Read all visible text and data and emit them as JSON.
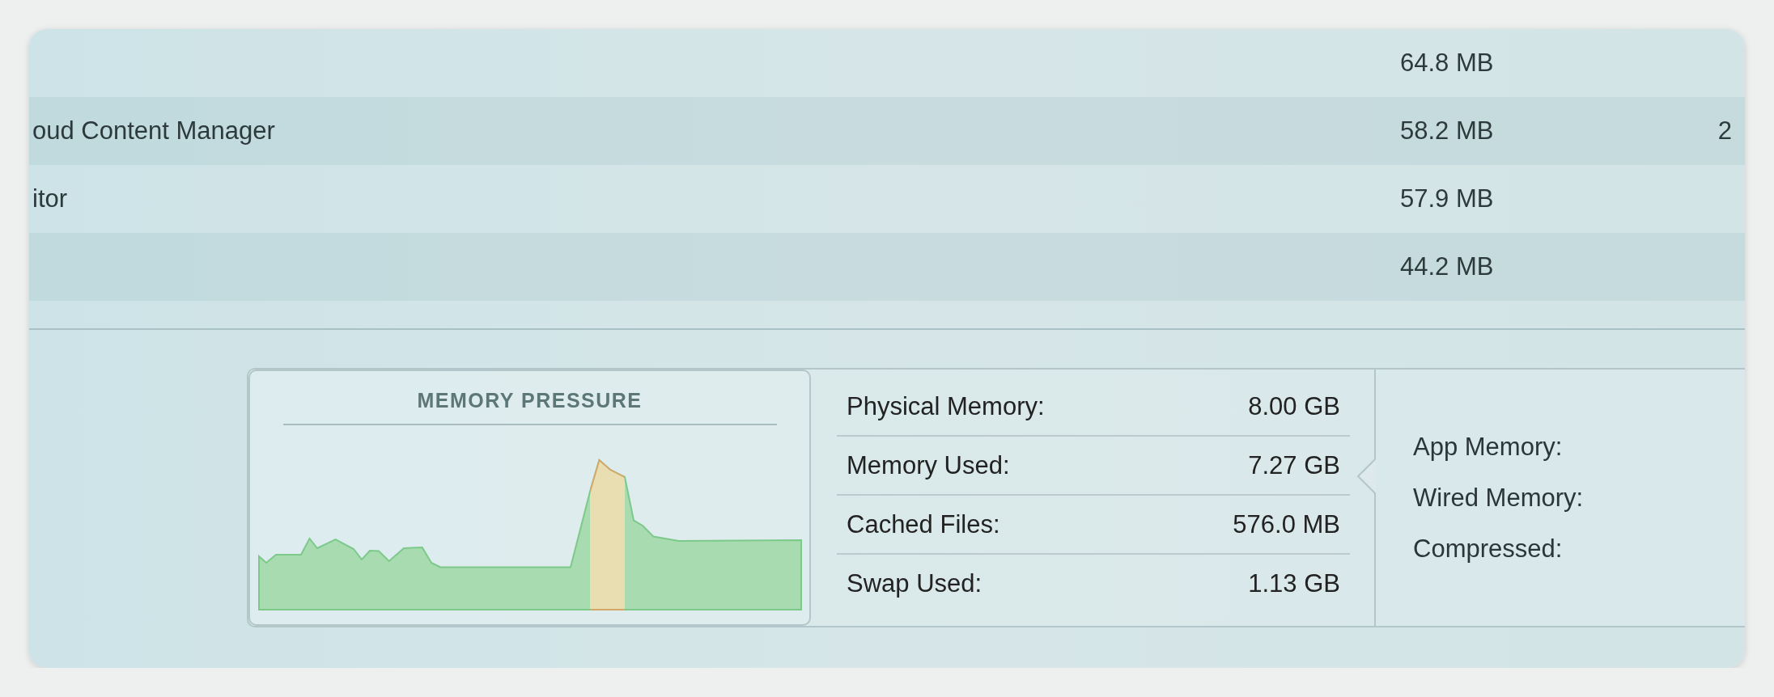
{
  "table": {
    "rows": [
      {
        "memory": "64.8 MB"
      },
      {
        "name": "oud Content Manager",
        "memory": "58.2 MB",
        "column_3": "2"
      },
      {
        "name": "itor",
        "memory": "57.9 MB"
      },
      {
        "memory": "44.2 MB"
      }
    ]
  },
  "memory_pressure": {
    "title": "MEMORY PRESSURE"
  },
  "stats": [
    {
      "label": "Physical Memory:",
      "value": "8.00 GB"
    },
    {
      "label": "Memory Used:",
      "value": "7.27 GB"
    },
    {
      "label": "Cached Files:",
      "value": "576.0 MB"
    },
    {
      "label": "Swap Used:",
      "value": "1.13 GB"
    }
  ],
  "breakdown": [
    {
      "label": "App Memory:"
    },
    {
      "label": "Wired Memory:"
    },
    {
      "label": "Compressed:"
    }
  ]
}
